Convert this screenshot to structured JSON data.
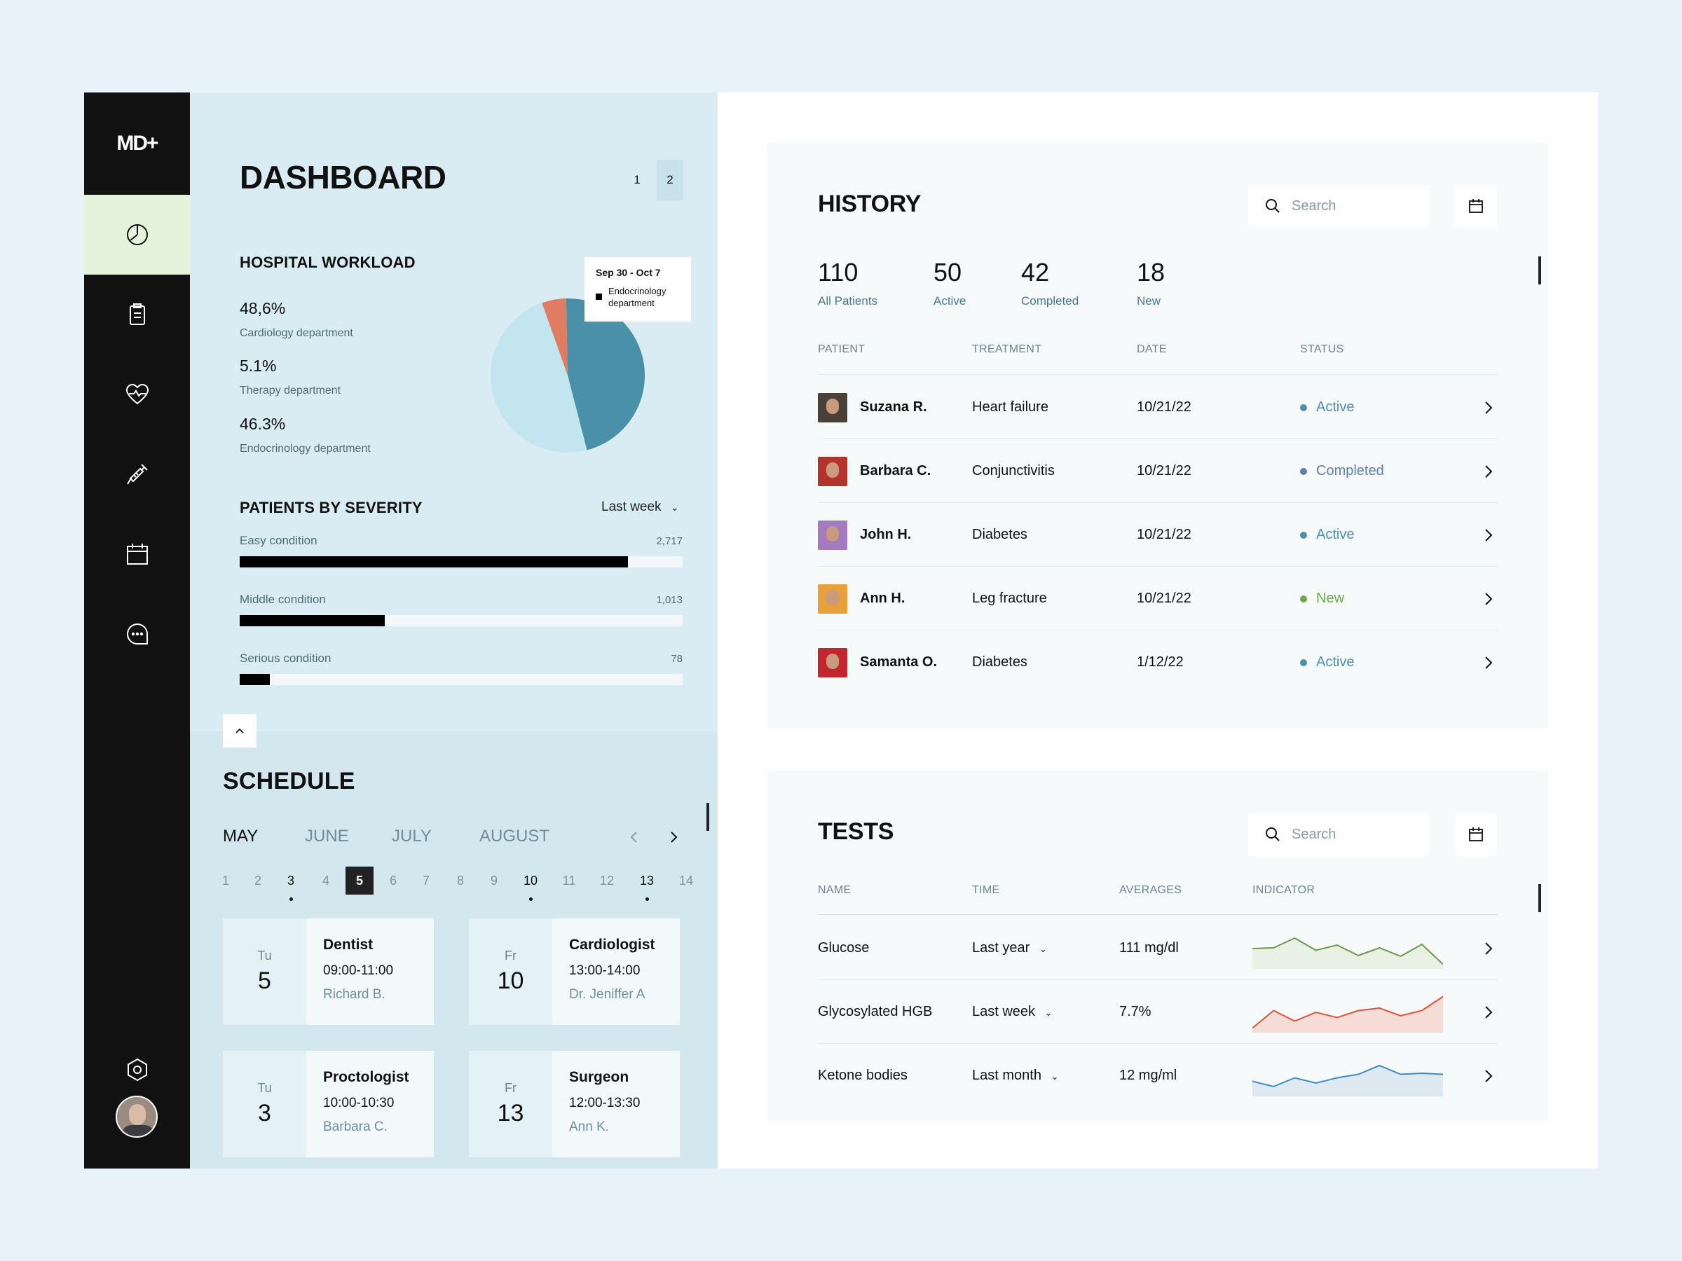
{
  "brand": {
    "logo": "MD+"
  },
  "nav": [
    {
      "name": "dashboard",
      "icon": "pie-chart-icon"
    },
    {
      "name": "records",
      "icon": "clipboard-icon"
    },
    {
      "name": "health",
      "icon": "heartbeat-icon"
    },
    {
      "name": "vaccines",
      "icon": "syringe-icon"
    },
    {
      "name": "calendar",
      "icon": "calendar-icon"
    },
    {
      "name": "messages",
      "icon": "chat-icon"
    },
    {
      "name": "settings",
      "icon": "hexagon-settings-icon"
    },
    {
      "name": "profile",
      "icon": "user-avatar"
    }
  ],
  "dashboard": {
    "title": "DASHBOARD",
    "pages": [
      "1",
      "2"
    ],
    "active_page": "2"
  },
  "workload": {
    "title": "HOSPITAL WORKLOAD",
    "stats": [
      {
        "value": "48,6%",
        "label": "Cardiology department"
      },
      {
        "value": "5.1%",
        "label": "Therapy department"
      },
      {
        "value": "46.3%",
        "label": "Endocrinology department"
      }
    ],
    "tooltip": {
      "date": "Sep 30 - Oct 7",
      "label": "Endocrinology department"
    }
  },
  "chart_data": {
    "type": "pie",
    "slices": [
      {
        "label": "Cardiology department",
        "value": 48.6,
        "color": "#c2e5ef"
      },
      {
        "label": "Therapy department",
        "value": 5.1,
        "color": "#e07c62"
      },
      {
        "label": "Endocrinology department",
        "value": 46.3,
        "color": "#4a90a8"
      }
    ]
  },
  "severity": {
    "title": "PATIENTS BY SEVERITY",
    "period": "Last week",
    "max": 3100,
    "items": [
      {
        "label": "Easy condition",
        "value": "2,717",
        "amount": 2717
      },
      {
        "label": "Middle condition",
        "value": "1,013",
        "amount": 1013
      },
      {
        "label": "Serious condition",
        "value": "78",
        "amount": 210
      }
    ]
  },
  "schedule": {
    "title": "SCHEDULE",
    "months": [
      "MAY",
      "JUNE",
      "JULY",
      "AUGUST"
    ],
    "active_month": "MAY",
    "days": [
      "1",
      "2",
      "3",
      "4",
      "5",
      "6",
      "7",
      "8",
      "9",
      "10",
      "11",
      "12",
      "13",
      "14"
    ],
    "selected_day": "5",
    "event_days": [
      "3",
      "10",
      "13"
    ],
    "appointments": [
      {
        "dow": "Tu",
        "day": "5",
        "title": "Dentist",
        "time": "09:00-11:00",
        "doctor": "Richard B."
      },
      {
        "dow": "Fr",
        "day": "10",
        "title": "Cardiologist",
        "time": "13:00-14:00",
        "doctor": "Dr. Jeniffer A"
      },
      {
        "dow": "Tu",
        "day": "3",
        "title": "Proctologist",
        "time": "10:00-10:30",
        "doctor": "Barbara C."
      },
      {
        "dow": "Fr",
        "day": "13",
        "title": "Surgeon",
        "time": "12:00-13:30",
        "doctor": "Ann K."
      }
    ]
  },
  "history": {
    "title": "HISTORY",
    "search_placeholder": "Search",
    "stats": [
      {
        "value": "110",
        "label": "All Patients"
      },
      {
        "value": "50",
        "label": "Active"
      },
      {
        "value": "42",
        "label": "Completed"
      },
      {
        "value": "18",
        "label": "New"
      }
    ],
    "columns": [
      "PATIENT",
      "TREATMENT",
      "DATE",
      "STATUS"
    ],
    "rows": [
      {
        "patient": "Suzana R.",
        "treatment": "Heart failure",
        "date": "10/21/22",
        "status": "Active",
        "status_color": "#4a8fb3",
        "avatar_color": "#4a4038"
      },
      {
        "patient": "Barbara C.",
        "treatment": "Conjunctivitis",
        "date": "10/21/22",
        "status": "Completed",
        "status_color": "#5c7cb8",
        "avatar_color": "#b5332f"
      },
      {
        "patient": "John H.",
        "treatment": "Diabetes",
        "date": "10/21/22",
        "status": "Active",
        "status_color": "#4a8fb3",
        "avatar_color": "#a47bbf"
      },
      {
        "patient": "Ann H.",
        "treatment": "Leg fracture",
        "date": "10/21/22",
        "status": "New",
        "status_color": "#6aa84a",
        "avatar_color": "#e8a13a"
      },
      {
        "patient": "Samanta O.",
        "treatment": "Diabetes",
        "date": "1/12/22",
        "status": "Active",
        "status_color": "#4a8fb3",
        "avatar_color": "#c4262f"
      }
    ]
  },
  "tests": {
    "title": "TESTS",
    "search_placeholder": "Search",
    "columns": [
      "NAME",
      "TIME",
      "AVERAGES",
      "INDICATOR"
    ],
    "rows": [
      {
        "name": "Glucose",
        "time": "Last year",
        "avg": "111 mg/dl",
        "color": "#6a9a4a",
        "fill": "#e9f0e4",
        "spark": [
          0.5,
          0.52,
          0.8,
          0.45,
          0.6,
          0.3,
          0.52,
          0.28,
          0.62,
          0.05
        ]
      },
      {
        "name": "Glycosylated HGB",
        "time": "Last week",
        "avg": "7.7%",
        "color": "#e0533a",
        "fill": "#f6dcd7",
        "spark": [
          0.05,
          0.55,
          0.25,
          0.5,
          0.35,
          0.55,
          0.62,
          0.4,
          0.55,
          0.95
        ]
      },
      {
        "name": "Ketone bodies",
        "time": "Last month",
        "avg": "12 mg/ml",
        "color": "#3b8bc4",
        "fill": "#dfe9f1",
        "spark": [
          0.35,
          0.2,
          0.45,
          0.3,
          0.45,
          0.55,
          0.8,
          0.55,
          0.58,
          0.55
        ]
      }
    ]
  }
}
